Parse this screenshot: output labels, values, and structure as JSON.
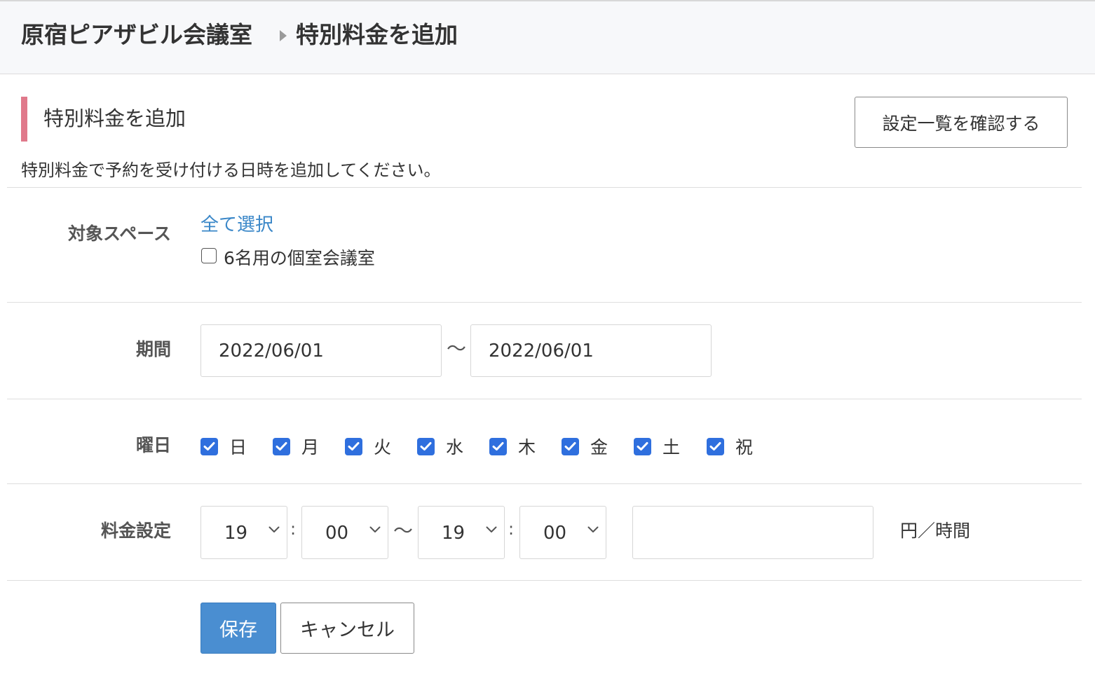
{
  "breadcrumb": {
    "venue": "原宿ピアザビル会議室",
    "current": "特別料金を追加"
  },
  "section": {
    "title": "特別料金を追加",
    "list_button": "設定一覧を確認する",
    "description": "特別料金で予約を受け付ける日時を追加してください。",
    "accent_color": "#e0798b"
  },
  "form": {
    "spaces": {
      "label": "対象スペース",
      "select_all": "全て選択",
      "options": [
        {
          "name": "6名用の個室会議室",
          "checked": false
        }
      ]
    },
    "period": {
      "label": "期間",
      "start": "2022/06/01",
      "separator": "〜",
      "end": "2022/06/01"
    },
    "weekdays": {
      "label": "曜日",
      "days": [
        {
          "label": "日",
          "checked": true
        },
        {
          "label": "月",
          "checked": true
        },
        {
          "label": "火",
          "checked": true
        },
        {
          "label": "水",
          "checked": true
        },
        {
          "label": "木",
          "checked": true
        },
        {
          "label": "金",
          "checked": true
        },
        {
          "label": "土",
          "checked": true
        },
        {
          "label": "祝",
          "checked": true
        }
      ]
    },
    "pricing": {
      "label": "料金設定",
      "start_hour": "19",
      "start_minute": "00",
      "end_hour": "19",
      "end_minute": "00",
      "colon": ":",
      "separator": "〜",
      "price": "",
      "unit": "円／時間"
    }
  },
  "actions": {
    "save": "保存",
    "cancel": "キャンセル",
    "save_color": "#4a8ed1"
  },
  "icons": {
    "checkbox_checked": "checkmark-icon",
    "select_arrow": "chevron-down-icon",
    "breadcrumb_separator": "triangle-right-icon"
  }
}
